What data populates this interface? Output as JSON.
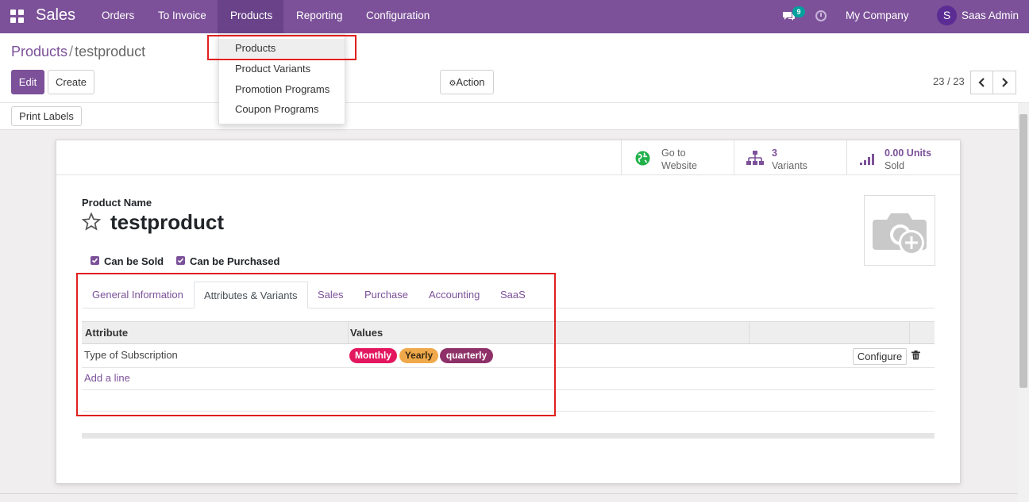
{
  "navbar": {
    "app_title": "Sales",
    "menu": [
      "Orders",
      "To Invoice",
      "Products",
      "Reporting",
      "Configuration"
    ],
    "active_menu": "Products",
    "message_count": "9",
    "company": "My Company",
    "user_initial": "S",
    "user_name": "Saas Admin",
    "bg_color": "#7c5199"
  },
  "dropdown": {
    "items": [
      "Products",
      "Product Variants",
      "Promotion Programs",
      "Coupon Programs"
    ],
    "active_item": "Products"
  },
  "breadcrumb": {
    "parent": "Products",
    "separator": "/",
    "current": "testproduct"
  },
  "buttons": {
    "edit": "Edit",
    "create": "Create",
    "action": "Action",
    "print_labels": "Print Labels"
  },
  "pager": {
    "value": "23 / 23"
  },
  "smart_buttons": {
    "website_line1": "Go to",
    "website_line2": "Website",
    "variants_value": "3",
    "variants_label": "Variants",
    "sold_value": "0.00 Units",
    "sold_label": "Sold"
  },
  "form": {
    "name_label": "Product Name",
    "name": "testproduct",
    "can_be_sold": "Can be Sold",
    "can_be_purchased": "Can be Purchased"
  },
  "tabs": [
    "General Information",
    "Attributes & Variants",
    "Sales",
    "Purchase",
    "Accounting",
    "SaaS"
  ],
  "active_tab": "Attributes & Variants",
  "table": {
    "headers": [
      "Attribute",
      "Values"
    ],
    "rows": [
      {
        "attribute": "Type of Subscription",
        "values": [
          {
            "label": "Monthly",
            "color": "#e3175e"
          },
          {
            "label": "Yearly",
            "color": "#f0a94a"
          },
          {
            "label": "quarterly",
            "color": "#8e3168"
          }
        ],
        "configure_label": "Configure"
      }
    ],
    "add_line": "Add a line"
  },
  "colors": {
    "accent": "#7c5199",
    "highlight": "#e0201f"
  }
}
